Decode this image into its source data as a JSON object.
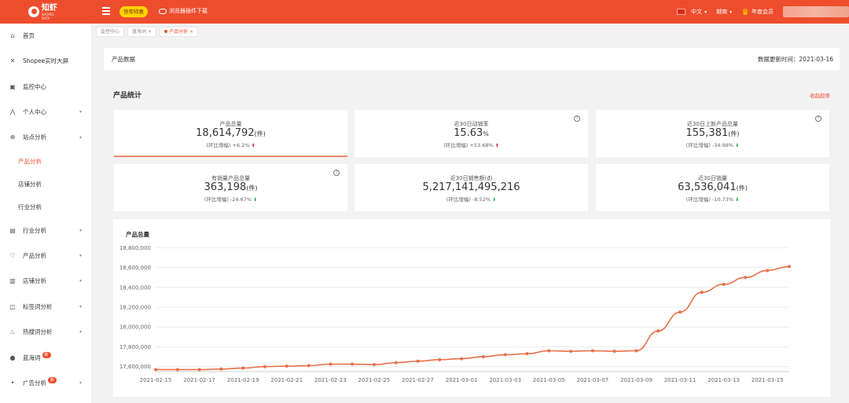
{
  "header": {
    "logo_text": "知虾",
    "logo_sub": "SHOPEE DATA",
    "quick_button": "快零特惠",
    "plugin_download": "浏览器插件下载",
    "language": "中文",
    "region": "越南",
    "membership": "年度会员",
    "brand_color": "#ee4d2d"
  },
  "sidebar": {
    "items": [
      {
        "icon": "home-icon",
        "label": "首页"
      },
      {
        "icon": "close-icon",
        "label": "Shopee实时大屏"
      },
      {
        "icon": "monitor-icon",
        "label": "监控中心"
      },
      {
        "icon": "person-icon",
        "label": "个人中心"
      },
      {
        "icon": "globe-icon",
        "label": "站点分析"
      },
      {
        "label": "产品分析"
      },
      {
        "label": "店铺分析"
      },
      {
        "label": "行业分析"
      },
      {
        "icon": "document-icon",
        "label": "行业分析"
      },
      {
        "icon": "product-icon",
        "label": "产品分析"
      },
      {
        "icon": "store-icon",
        "label": "店铺分析"
      },
      {
        "icon": "bookmark-icon",
        "label": "标签词分析"
      },
      {
        "icon": "hot-icon",
        "label": "热搜词分析"
      },
      {
        "icon": "blue-ocean-icon",
        "label": "蓝海词",
        "badge": "新"
      },
      {
        "icon": "ad-icon",
        "label": "广告分析",
        "badge": "新"
      }
    ]
  },
  "tabs": [
    "监控中心",
    "蓝海词",
    "产品分析"
  ],
  "data_bar": {
    "title": "产品数据",
    "update_time": "数据更新时间：2021-03-16"
  },
  "stats": {
    "title": "产品统计",
    "collapse": "收起趋势",
    "cards": [
      {
        "label": "产品总量",
        "value": "18,614,792",
        "unit": "(件)",
        "change_label": "(环比增幅)",
        "change": "+6.2%",
        "direction": "up"
      },
      {
        "label": "近30日动销率",
        "value": "15.63",
        "unit": "%",
        "change_label": "(环比增幅)",
        "change": "+53.68%",
        "direction": "up"
      },
      {
        "label": "近30日上新产品总量",
        "value": "155,381",
        "unit": "(件)",
        "change_label": "(环比增幅)",
        "change": "-34.98%",
        "direction": "down"
      },
      {
        "label": "有销量产品总量",
        "value": "363,198",
        "unit": "(件)",
        "change_label": "(环比增幅)",
        "change": "-24.67%",
        "direction": "down"
      },
      {
        "label": "近30日销售额(₫)",
        "value": "5,217,141,495,216",
        "unit": "",
        "change_label": "(环比增幅)",
        "change": "-8.52%",
        "direction": "down"
      },
      {
        "label": "近30日销量",
        "value": "63,536,041",
        "unit": "(件)",
        "change_label": "(环比增幅)",
        "change": "-10.73%",
        "direction": "down"
      }
    ]
  },
  "chart_data": {
    "type": "line",
    "title": "产品总量",
    "x": [
      "2021-02-15",
      "2021-02-16",
      "2021-02-17",
      "2021-02-18",
      "2021-02-19",
      "2021-02-20",
      "2021-02-21",
      "2021-02-22",
      "2021-02-23",
      "2021-02-24",
      "2021-02-25",
      "2021-02-26",
      "2021-02-27",
      "2021-02-28",
      "2021-03-01",
      "2021-03-02",
      "2021-03-03",
      "2021-03-04",
      "2021-03-05",
      "2021-03-06",
      "2021-03-07",
      "2021-03-08",
      "2021-03-09",
      "2021-03-10",
      "2021-03-11",
      "2021-03-12",
      "2021-03-13",
      "2021-03-14",
      "2021-03-15",
      "2021-03-16"
    ],
    "x_ticks": [
      "2021-02-15",
      "2021-02-17",
      "2021-02-19",
      "2021-02-21",
      "2021-02-23",
      "2021-02-25",
      "2021-02-27",
      "2021-03-01",
      "2021-03-03",
      "2021-03-05",
      "2021-03-07",
      "2021-03-09",
      "2021-03-11",
      "2021-03-13",
      "2021-03-15"
    ],
    "series": [
      {
        "values": [
          17570000,
          17570000,
          17570000,
          17575000,
          17585000,
          17600000,
          17605000,
          17610000,
          17625000,
          17625000,
          17620000,
          17640000,
          17655000,
          17670000,
          17680000,
          17700000,
          17720000,
          17730000,
          17760000,
          17755000,
          17760000,
          17755000,
          17760000,
          17960000,
          18150000,
          18350000,
          18430000,
          18500000,
          18570000,
          18610000
        ]
      }
    ],
    "y_ticks": [
      17600000,
      17800000,
      18000000,
      18200000,
      18400000,
      18600000,
      18800000
    ],
    "ylim": [
      17550000,
      18850000
    ],
    "line_color": "#e8714a",
    "grid": true
  }
}
